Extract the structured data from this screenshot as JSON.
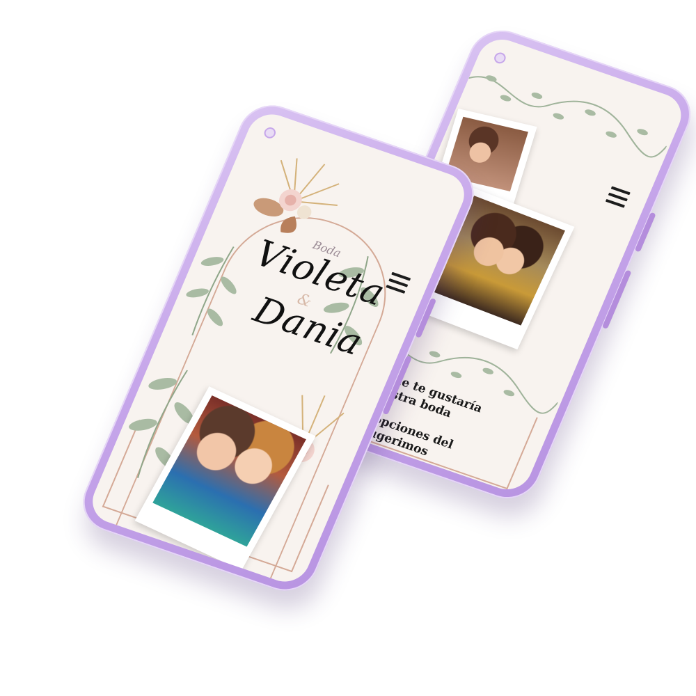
{
  "front_screen": {
    "subtitle": "Boda",
    "name_one": "Violeta",
    "ampersand": "&",
    "name_two": "Dania"
  },
  "back_screen": {
    "rsvp_line_one": "n que te gustaría\nnuestra boda",
    "rsvp_line_two": "er opciones del\ne sugerimos"
  },
  "icons": [
    "hamburger-menu-icon",
    "camera-icon",
    "chevron-down-icon"
  ],
  "colors": {
    "phone_case": "#c6a6ea",
    "screen_bg": "#f8f3ef",
    "frame_line": "#d4a996",
    "leaf_green": "#9fb39a",
    "title_text": "#111111"
  }
}
